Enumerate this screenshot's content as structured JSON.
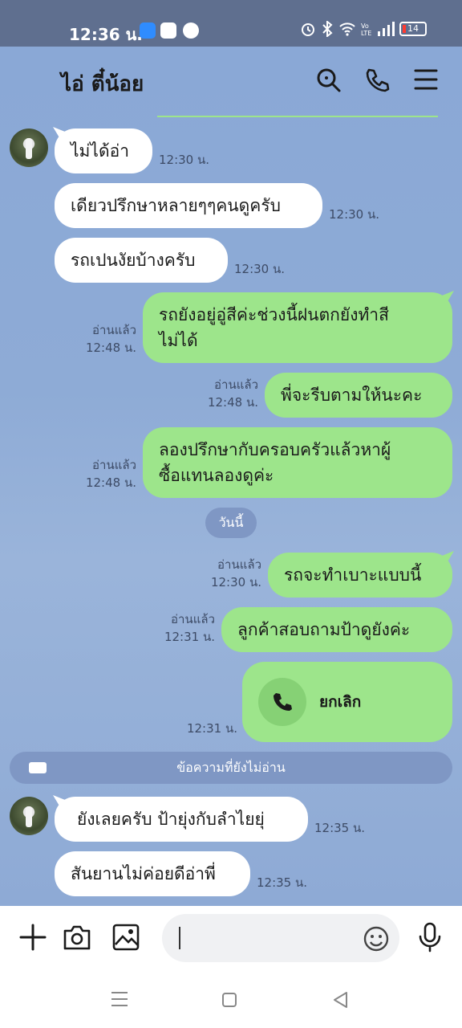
{
  "status": {
    "time": "12:36 น.",
    "battery": "14"
  },
  "header": {
    "title": "ไอ่ ตี๋น้อย"
  },
  "messages": {
    "m1": {
      "text": "ไม่ได้อ่า",
      "time": "12:30 น."
    },
    "m2": {
      "text": "เดียวปรึกษาหลายๆๆคนดูครับ",
      "time": "12:30 น."
    },
    "m3": {
      "text": "รถเปนงัยบ้างครับ",
      "time": "12:30 น."
    },
    "m4": {
      "line1": "รถยังอยู่อู่สีค่ะช่วงนี้ฝนตกยังทำสี",
      "line2": "ไม่ได้",
      "read": "อ่านแล้ว",
      "time": "12:48 น."
    },
    "m5": {
      "text": "พี่จะรีบตามให้นะคะ",
      "read": "อ่านแล้ว",
      "time": "12:48 น."
    },
    "m6": {
      "line1": "ลองปรึกษากับครอบครัวแล้วหาผู้",
      "line2": "ซื้อแทนลองดูค่ะ",
      "read": "อ่านแล้ว",
      "time": "12:48 น."
    },
    "day": "วันนี้",
    "m7": {
      "text": "รถจะทำเบาะแบบนี้",
      "read": "อ่านแล้ว",
      "time": "12:30 น."
    },
    "m8": {
      "text": "ลูกค้าสอบถามป้าดูยังค่ะ",
      "read": "อ่านแล้ว",
      "time": "12:31 น."
    },
    "m9": {
      "call_label": "ยกเลิก",
      "time": "12:31 น."
    },
    "unread": "ข้อความที่ยังไม่อ่าน",
    "m10": {
      "text": "ยังเลยครับ ป้ายุ่งกับลำไยยุ่",
      "time": "12:35 น."
    },
    "m11": {
      "text": "สันยานไม่ค่อยดีอ่าพี่",
      "time": "12:35 น."
    }
  },
  "input": {
    "placeholder": ""
  },
  "colors": {
    "outgoing": "#9de58b",
    "incoming": "#ffffff",
    "chat_bg": "#8eabd6"
  }
}
